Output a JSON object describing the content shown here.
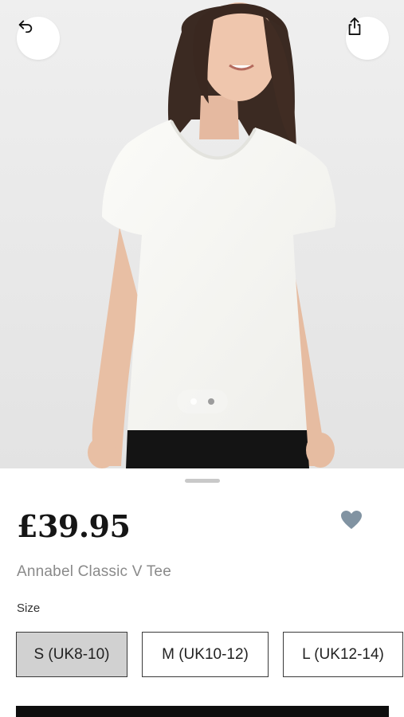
{
  "product_image": {
    "description_icon": "product-photo",
    "carousel": {
      "total": 2,
      "active_index": 1
    }
  },
  "top_actions": {
    "back_icon": "back-arrow-icon",
    "share_icon": "share-icon"
  },
  "product": {
    "price": "£39.95",
    "name": "Annabel Classic V Tee"
  },
  "size_section": {
    "label": "Size",
    "options": [
      {
        "label": "S (UK8-10)",
        "selected": true
      },
      {
        "label": "M (UK10-12)",
        "selected": false
      },
      {
        "label": "L (UK12-14)",
        "selected": false
      }
    ]
  },
  "colors": {
    "wishlist_heart": "#8193a2",
    "selected_size_bg": "#d1d1d1",
    "cta_bg": "#0e0e0e"
  }
}
